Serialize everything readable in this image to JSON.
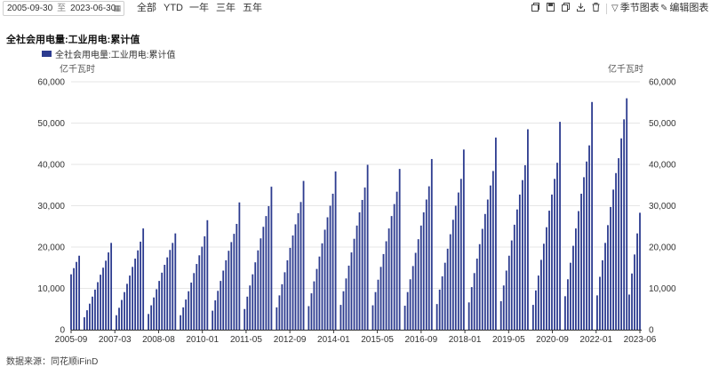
{
  "toolbar": {
    "date_start": "2005-09-30",
    "date_sep": "至",
    "date_end": "2023-06-30",
    "range_buttons": [
      "全部",
      "YTD",
      "一年",
      "三年",
      "五年"
    ],
    "icons": [
      "copy-icon",
      "save-icon",
      "duplicate-icon",
      "download-icon",
      "delete-icon"
    ],
    "seasonal_chart_label": "季节图表",
    "edit_chart_label": "编辑图表"
  },
  "source_label": "数据来源：同花顺iFinD",
  "colors": {
    "bar": "#2c3b8f",
    "grid": "#e6e6e6",
    "axis": "#333333"
  },
  "chart_data": {
    "type": "bar",
    "title": "全社会用电量:工业用电:累计值",
    "legend_position": "top-left",
    "grid": true,
    "y_unit_left": "亿千瓦时",
    "y_unit_right": "亿千瓦时",
    "ylim": [
      0,
      60000
    ],
    "yticks": [
      0,
      10000,
      20000,
      30000,
      40000,
      50000,
      60000
    ],
    "ytick_labels": [
      "0",
      "10,000",
      "20,000",
      "30,000",
      "40,000",
      "50,000",
      "60,000"
    ],
    "xtick_labels": [
      "2005-09",
      "2007-03",
      "2008-08",
      "2010-01",
      "2011-05",
      "2012-09",
      "2014-01",
      "2015-05",
      "2016-09",
      "2018-01",
      "2019-05",
      "2020-09",
      "2022-01",
      "2023-06"
    ],
    "series": [
      {
        "name": "全社会用电量:工业用电:累计值",
        "points": [
          {
            "x": "2005-09",
            "y": 13400
          },
          {
            "x": "2005-10",
            "y": 14900
          },
          {
            "x": "2005-11",
            "y": 16400
          },
          {
            "x": "2005-12",
            "y": 17900
          },
          {
            "x": "2006-02",
            "y": 3000
          },
          {
            "x": "2006-03",
            "y": 4700
          },
          {
            "x": "2006-04",
            "y": 6300
          },
          {
            "x": "2006-05",
            "y": 8000
          },
          {
            "x": "2006-06",
            "y": 9700
          },
          {
            "x": "2006-07",
            "y": 11500
          },
          {
            "x": "2006-08",
            "y": 13300
          },
          {
            "x": "2006-09",
            "y": 15000
          },
          {
            "x": "2006-10",
            "y": 16700
          },
          {
            "x": "2006-11",
            "y": 18700
          },
          {
            "x": "2006-12",
            "y": 21000
          },
          {
            "x": "2007-02",
            "y": 3500
          },
          {
            "x": "2007-03",
            "y": 5300
          },
          {
            "x": "2007-04",
            "y": 7200
          },
          {
            "x": "2007-05",
            "y": 9100
          },
          {
            "x": "2007-06",
            "y": 11100
          },
          {
            "x": "2007-07",
            "y": 13100
          },
          {
            "x": "2007-08",
            "y": 15200
          },
          {
            "x": "2007-09",
            "y": 17200
          },
          {
            "x": "2007-10",
            "y": 19200
          },
          {
            "x": "2007-11",
            "y": 21300
          },
          {
            "x": "2007-12",
            "y": 24500
          },
          {
            "x": "2008-02",
            "y": 3800
          },
          {
            "x": "2008-03",
            "y": 5900
          },
          {
            "x": "2008-04",
            "y": 7800
          },
          {
            "x": "2008-05",
            "y": 9800
          },
          {
            "x": "2008-06",
            "y": 11800
          },
          {
            "x": "2008-07",
            "y": 13800
          },
          {
            "x": "2008-08",
            "y": 15700
          },
          {
            "x": "2008-09",
            "y": 17500
          },
          {
            "x": "2008-10",
            "y": 19300
          },
          {
            "x": "2008-11",
            "y": 21000
          },
          {
            "x": "2008-12",
            "y": 23300
          },
          {
            "x": "2009-02",
            "y": 3500
          },
          {
            "x": "2009-03",
            "y": 5400
          },
          {
            "x": "2009-04",
            "y": 7300
          },
          {
            "x": "2009-05",
            "y": 9300
          },
          {
            "x": "2009-06",
            "y": 11400
          },
          {
            "x": "2009-07",
            "y": 13700
          },
          {
            "x": "2009-08",
            "y": 15900
          },
          {
            "x": "2009-09",
            "y": 18000
          },
          {
            "x": "2009-10",
            "y": 20100
          },
          {
            "x": "2009-11",
            "y": 22600
          },
          {
            "x": "2009-12",
            "y": 26500
          },
          {
            "x": "2010-02",
            "y": 4600
          },
          {
            "x": "2010-03",
            "y": 7100
          },
          {
            "x": "2010-04",
            "y": 9400
          },
          {
            "x": "2010-05",
            "y": 11800
          },
          {
            "x": "2010-06",
            "y": 14300
          },
          {
            "x": "2010-07",
            "y": 16800
          },
          {
            "x": "2010-08",
            "y": 19100
          },
          {
            "x": "2010-09",
            "y": 21200
          },
          {
            "x": "2010-10",
            "y": 23200
          },
          {
            "x": "2010-11",
            "y": 25600
          },
          {
            "x": "2010-12",
            "y": 30800
          },
          {
            "x": "2011-02",
            "y": 5000
          },
          {
            "x": "2011-03",
            "y": 8000
          },
          {
            "x": "2011-04",
            "y": 10700
          },
          {
            "x": "2011-05",
            "y": 13400
          },
          {
            "x": "2011-06",
            "y": 16300
          },
          {
            "x": "2011-07",
            "y": 19200
          },
          {
            "x": "2011-08",
            "y": 22100
          },
          {
            "x": "2011-09",
            "y": 24900
          },
          {
            "x": "2011-10",
            "y": 27500
          },
          {
            "x": "2011-11",
            "y": 29900
          },
          {
            "x": "2011-12",
            "y": 34600
          },
          {
            "x": "2012-02",
            "y": 5400
          },
          {
            "x": "2012-03",
            "y": 8300
          },
          {
            "x": "2012-04",
            "y": 11000
          },
          {
            "x": "2012-05",
            "y": 13900
          },
          {
            "x": "2012-06",
            "y": 16800
          },
          {
            "x": "2012-07",
            "y": 19800
          },
          {
            "x": "2012-08",
            "y": 22800
          },
          {
            "x": "2012-09",
            "y": 25500
          },
          {
            "x": "2012-10",
            "y": 28200
          },
          {
            "x": "2012-11",
            "y": 30900
          },
          {
            "x": "2012-12",
            "y": 36000
          },
          {
            "x": "2013-02",
            "y": 5700
          },
          {
            "x": "2013-03",
            "y": 8800
          },
          {
            "x": "2013-04",
            "y": 11700
          },
          {
            "x": "2013-05",
            "y": 14700
          },
          {
            "x": "2013-06",
            "y": 17700
          },
          {
            "x": "2013-07",
            "y": 20900
          },
          {
            "x": "2013-08",
            "y": 24200
          },
          {
            "x": "2013-09",
            "y": 27200
          },
          {
            "x": "2013-10",
            "y": 30000
          },
          {
            "x": "2013-11",
            "y": 32900
          },
          {
            "x": "2013-12",
            "y": 38300
          },
          {
            "x": "2014-02",
            "y": 6000
          },
          {
            "x": "2014-03",
            "y": 9300
          },
          {
            "x": "2014-04",
            "y": 12400
          },
          {
            "x": "2014-05",
            "y": 15500
          },
          {
            "x": "2014-06",
            "y": 18700
          },
          {
            "x": "2014-07",
            "y": 22000
          },
          {
            "x": "2014-08",
            "y": 25200
          },
          {
            "x": "2014-09",
            "y": 28400
          },
          {
            "x": "2014-10",
            "y": 31400
          },
          {
            "x": "2014-11",
            "y": 34400
          },
          {
            "x": "2014-12",
            "y": 39900
          },
          {
            "x": "2015-02",
            "y": 5900
          },
          {
            "x": "2015-03",
            "y": 9100
          },
          {
            "x": "2015-04",
            "y": 12100
          },
          {
            "x": "2015-05",
            "y": 15200
          },
          {
            "x": "2015-06",
            "y": 18300
          },
          {
            "x": "2015-07",
            "y": 21400
          },
          {
            "x": "2015-08",
            "y": 24500
          },
          {
            "x": "2015-09",
            "y": 27500
          },
          {
            "x": "2015-10",
            "y": 30400
          },
          {
            "x": "2015-11",
            "y": 33400
          },
          {
            "x": "2015-12",
            "y": 38900
          },
          {
            "x": "2016-02",
            "y": 5800
          },
          {
            "x": "2016-03",
            "y": 9100
          },
          {
            "x": "2016-04",
            "y": 12200
          },
          {
            "x": "2016-05",
            "y": 15400
          },
          {
            "x": "2016-06",
            "y": 18600
          },
          {
            "x": "2016-07",
            "y": 21900
          },
          {
            "x": "2016-08",
            "y": 25200
          },
          {
            "x": "2016-09",
            "y": 28400
          },
          {
            "x": "2016-10",
            "y": 31500
          },
          {
            "x": "2016-11",
            "y": 34700
          },
          {
            "x": "2016-12",
            "y": 41300
          },
          {
            "x": "2017-02",
            "y": 6200
          },
          {
            "x": "2017-03",
            "y": 9700
          },
          {
            "x": "2017-04",
            "y": 12900
          },
          {
            "x": "2017-05",
            "y": 16200
          },
          {
            "x": "2017-06",
            "y": 19600
          },
          {
            "x": "2017-07",
            "y": 23100
          },
          {
            "x": "2017-08",
            "y": 26600
          },
          {
            "x": "2017-09",
            "y": 30000
          },
          {
            "x": "2017-10",
            "y": 33200
          },
          {
            "x": "2017-11",
            "y": 36500
          },
          {
            "x": "2017-12",
            "y": 43600
          },
          {
            "x": "2018-02",
            "y": 6600
          },
          {
            "x": "2018-03",
            "y": 10300
          },
          {
            "x": "2018-04",
            "y": 13700
          },
          {
            "x": "2018-05",
            "y": 17200
          },
          {
            "x": "2018-06",
            "y": 20700
          },
          {
            "x": "2018-07",
            "y": 24400
          },
          {
            "x": "2018-08",
            "y": 28000
          },
          {
            "x": "2018-09",
            "y": 31500
          },
          {
            "x": "2018-10",
            "y": 34900
          },
          {
            "x": "2018-11",
            "y": 38400
          },
          {
            "x": "2018-12",
            "y": 46500
          },
          {
            "x": "2019-02",
            "y": 6900
          },
          {
            "x": "2019-03",
            "y": 10700
          },
          {
            "x": "2019-04",
            "y": 14300
          },
          {
            "x": "2019-05",
            "y": 17900
          },
          {
            "x": "2019-06",
            "y": 21600
          },
          {
            "x": "2019-07",
            "y": 25400
          },
          {
            "x": "2019-08",
            "y": 29100
          },
          {
            "x": "2019-09",
            "y": 32700
          },
          {
            "x": "2019-10",
            "y": 36200
          },
          {
            "x": "2019-11",
            "y": 39800
          },
          {
            "x": "2019-12",
            "y": 48500
          },
          {
            "x": "2020-02",
            "y": 6000
          },
          {
            "x": "2020-03",
            "y": 9500
          },
          {
            "x": "2020-04",
            "y": 13100
          },
          {
            "x": "2020-05",
            "y": 16900
          },
          {
            "x": "2020-06",
            "y": 20800
          },
          {
            "x": "2020-07",
            "y": 24800
          },
          {
            "x": "2020-08",
            "y": 28800
          },
          {
            "x": "2020-09",
            "y": 32700
          },
          {
            "x": "2020-10",
            "y": 36500
          },
          {
            "x": "2020-11",
            "y": 40400
          },
          {
            "x": "2020-12",
            "y": 50300
          },
          {
            "x": "2021-02",
            "y": 8100
          },
          {
            "x": "2021-03",
            "y": 12200
          },
          {
            "x": "2021-04",
            "y": 16200
          },
          {
            "x": "2021-05",
            "y": 20300
          },
          {
            "x": "2021-06",
            "y": 24500
          },
          {
            "x": "2021-07",
            "y": 28700
          },
          {
            "x": "2021-08",
            "y": 32900
          },
          {
            "x": "2021-09",
            "y": 36900
          },
          {
            "x": "2021-10",
            "y": 40700
          },
          {
            "x": "2021-11",
            "y": 44600
          },
          {
            "x": "2021-12",
            "y": 55100
          },
          {
            "x": "2022-02",
            "y": 8300
          },
          {
            "x": "2022-03",
            "y": 12800
          },
          {
            "x": "2022-04",
            "y": 16800
          },
          {
            "x": "2022-05",
            "y": 21000
          },
          {
            "x": "2022-06",
            "y": 25300
          },
          {
            "x": "2022-07",
            "y": 29700
          },
          {
            "x": "2022-08",
            "y": 33900
          },
          {
            "x": "2022-09",
            "y": 37900
          },
          {
            "x": "2022-10",
            "y": 41500
          },
          {
            "x": "2022-11",
            "y": 46300
          },
          {
            "x": "2022-12",
            "y": 50900
          },
          {
            "x": "2023-01",
            "y": 56000
          },
          {
            "x": "2023-02",
            "y": 8500
          },
          {
            "x": "2023-03",
            "y": 13600
          },
          {
            "x": "2023-04",
            "y": 18200
          },
          {
            "x": "2023-05",
            "y": 23300
          },
          {
            "x": "2023-06",
            "y": 28300
          }
        ]
      }
    ]
  }
}
